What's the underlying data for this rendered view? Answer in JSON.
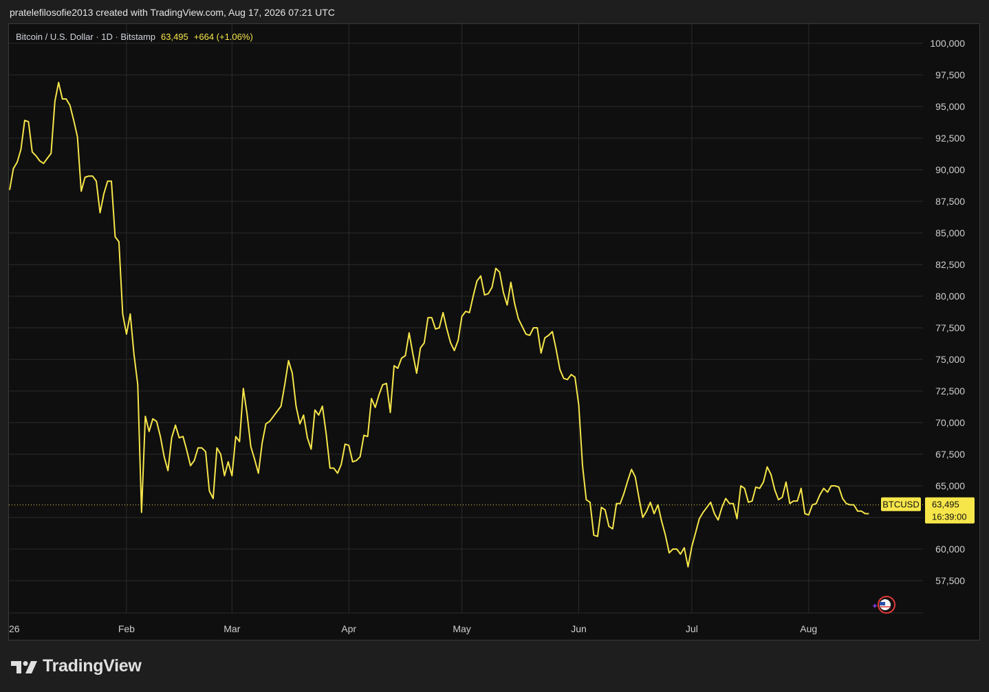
{
  "header": {
    "created_by": "pratelefilosofie2013 created with TradingView.com, Aug 17, 2026 07:21 UTC"
  },
  "legend": {
    "symbol": "Bitcoin / U.S. Dollar · 1D · Bitstamp",
    "last": "63,495",
    "change": "+664 (+1.06%)"
  },
  "brand": {
    "name": "TradingView"
  },
  "colors": {
    "line": "#f7e64a",
    "background": "#0f0f0f",
    "grid": "#2b2b2b",
    "axis_text": "#cfcfcf"
  },
  "chart_data": {
    "type": "line",
    "grid": true,
    "ylim": [
      55000,
      101000
    ],
    "y_ticks": [
      100000,
      97500,
      95000,
      92500,
      90000,
      87500,
      85000,
      82500,
      80000,
      77500,
      75000,
      72500,
      70000,
      67500,
      65000,
      62500,
      60000,
      57500
    ],
    "y_tick_labels": [
      "100,000",
      "97,500",
      "95,000",
      "92,500",
      "90,000",
      "87,500",
      "85,000",
      "82,500",
      "80,000",
      "77,500",
      "75,000",
      "72,500",
      "70,000",
      "67,500",
      "65,000",
      "",
      "60,000",
      "57,500"
    ],
    "x_start": "2026-01-01",
    "x_ticks": [
      {
        "day": 0,
        "label": "26"
      },
      {
        "day": 31,
        "label": "Feb"
      },
      {
        "day": 59,
        "label": "Mar"
      },
      {
        "day": 90,
        "label": "Apr"
      },
      {
        "day": 120,
        "label": "May"
      },
      {
        "day": 151,
        "label": "Jun"
      },
      {
        "day": 181,
        "label": "Jul"
      },
      {
        "day": 212,
        "label": "Aug"
      }
    ],
    "last_price": 63495,
    "last_price_label": "63,495",
    "countdown": "16:39:00",
    "series_label": "BTCUSD",
    "series": [
      {
        "name": "BTCUSD",
        "values": [
          88400,
          90100,
          90600,
          91600,
          93900,
          93800,
          91400,
          91100,
          90700,
          90500,
          90900,
          91300,
          95400,
          96900,
          95600,
          95600,
          95100,
          93900,
          92600,
          88300,
          89400,
          89500,
          89500,
          89100,
          86600,
          88100,
          89100,
          89100,
          84700,
          84300,
          78600,
          77000,
          78600,
          75400,
          73000,
          62900,
          70500,
          69300,
          70300,
          70100,
          68900,
          67300,
          66200,
          68800,
          69800,
          68800,
          68900,
          67800,
          66600,
          67000,
          68000,
          68000,
          67700,
          64600,
          64000,
          68000,
          67500,
          65800,
          66900,
          65800,
          68900,
          68500,
          72700,
          70700,
          68100,
          67100,
          66000,
          68400,
          69900,
          70100,
          70500,
          70900,
          71300,
          73000,
          74900,
          73900,
          71300,
          69900,
          70600,
          68800,
          67900,
          71000,
          70600,
          71300,
          69100,
          66400,
          66400,
          66000,
          66700,
          68300,
          68200,
          66900,
          67000,
          67300,
          69000,
          68900,
          71900,
          71200,
          72200,
          73000,
          73100,
          70800,
          74500,
          74300,
          75100,
          75300,
          77100,
          75400,
          73900,
          75900,
          76300,
          78300,
          78300,
          77400,
          77500,
          78700,
          77400,
          76300,
          75700,
          76500,
          78400,
          78800,
          78700,
          80000,
          81200,
          81600,
          80100,
          80200,
          80700,
          82200,
          81900,
          80300,
          79300,
          81100,
          79400,
          78200,
          77600,
          77000,
          76900,
          77500,
          77500,
          75500,
          76700,
          76900,
          77200,
          75800,
          74200,
          73500,
          73400,
          73800,
          73600,
          71400,
          66600,
          63900,
          63700,
          61100,
          61000,
          63300,
          63100,
          61800,
          61600,
          63600,
          63600,
          64400,
          65400,
          66300,
          65700,
          64000,
          62500,
          63000,
          63700,
          62800,
          63500,
          62200,
          61100,
          59700,
          60000,
          60000,
          59600,
          60100,
          58600,
          60200,
          61300,
          62400,
          62900,
          63300,
          63700,
          62800,
          62300,
          63300,
          64000,
          63600,
          63600,
          62400,
          65000,
          64800,
          63700,
          63800,
          64900,
          64800,
          65300,
          66500,
          65900,
          64700,
          63900,
          64100,
          65300,
          63600,
          63800,
          63800,
          64800,
          62800,
          62700,
          63500,
          63600,
          64300,
          64800,
          64500,
          65000,
          65000,
          64900,
          64000,
          63600,
          63500,
          63500,
          63000,
          63000,
          62800,
          62800
        ]
      }
    ]
  }
}
